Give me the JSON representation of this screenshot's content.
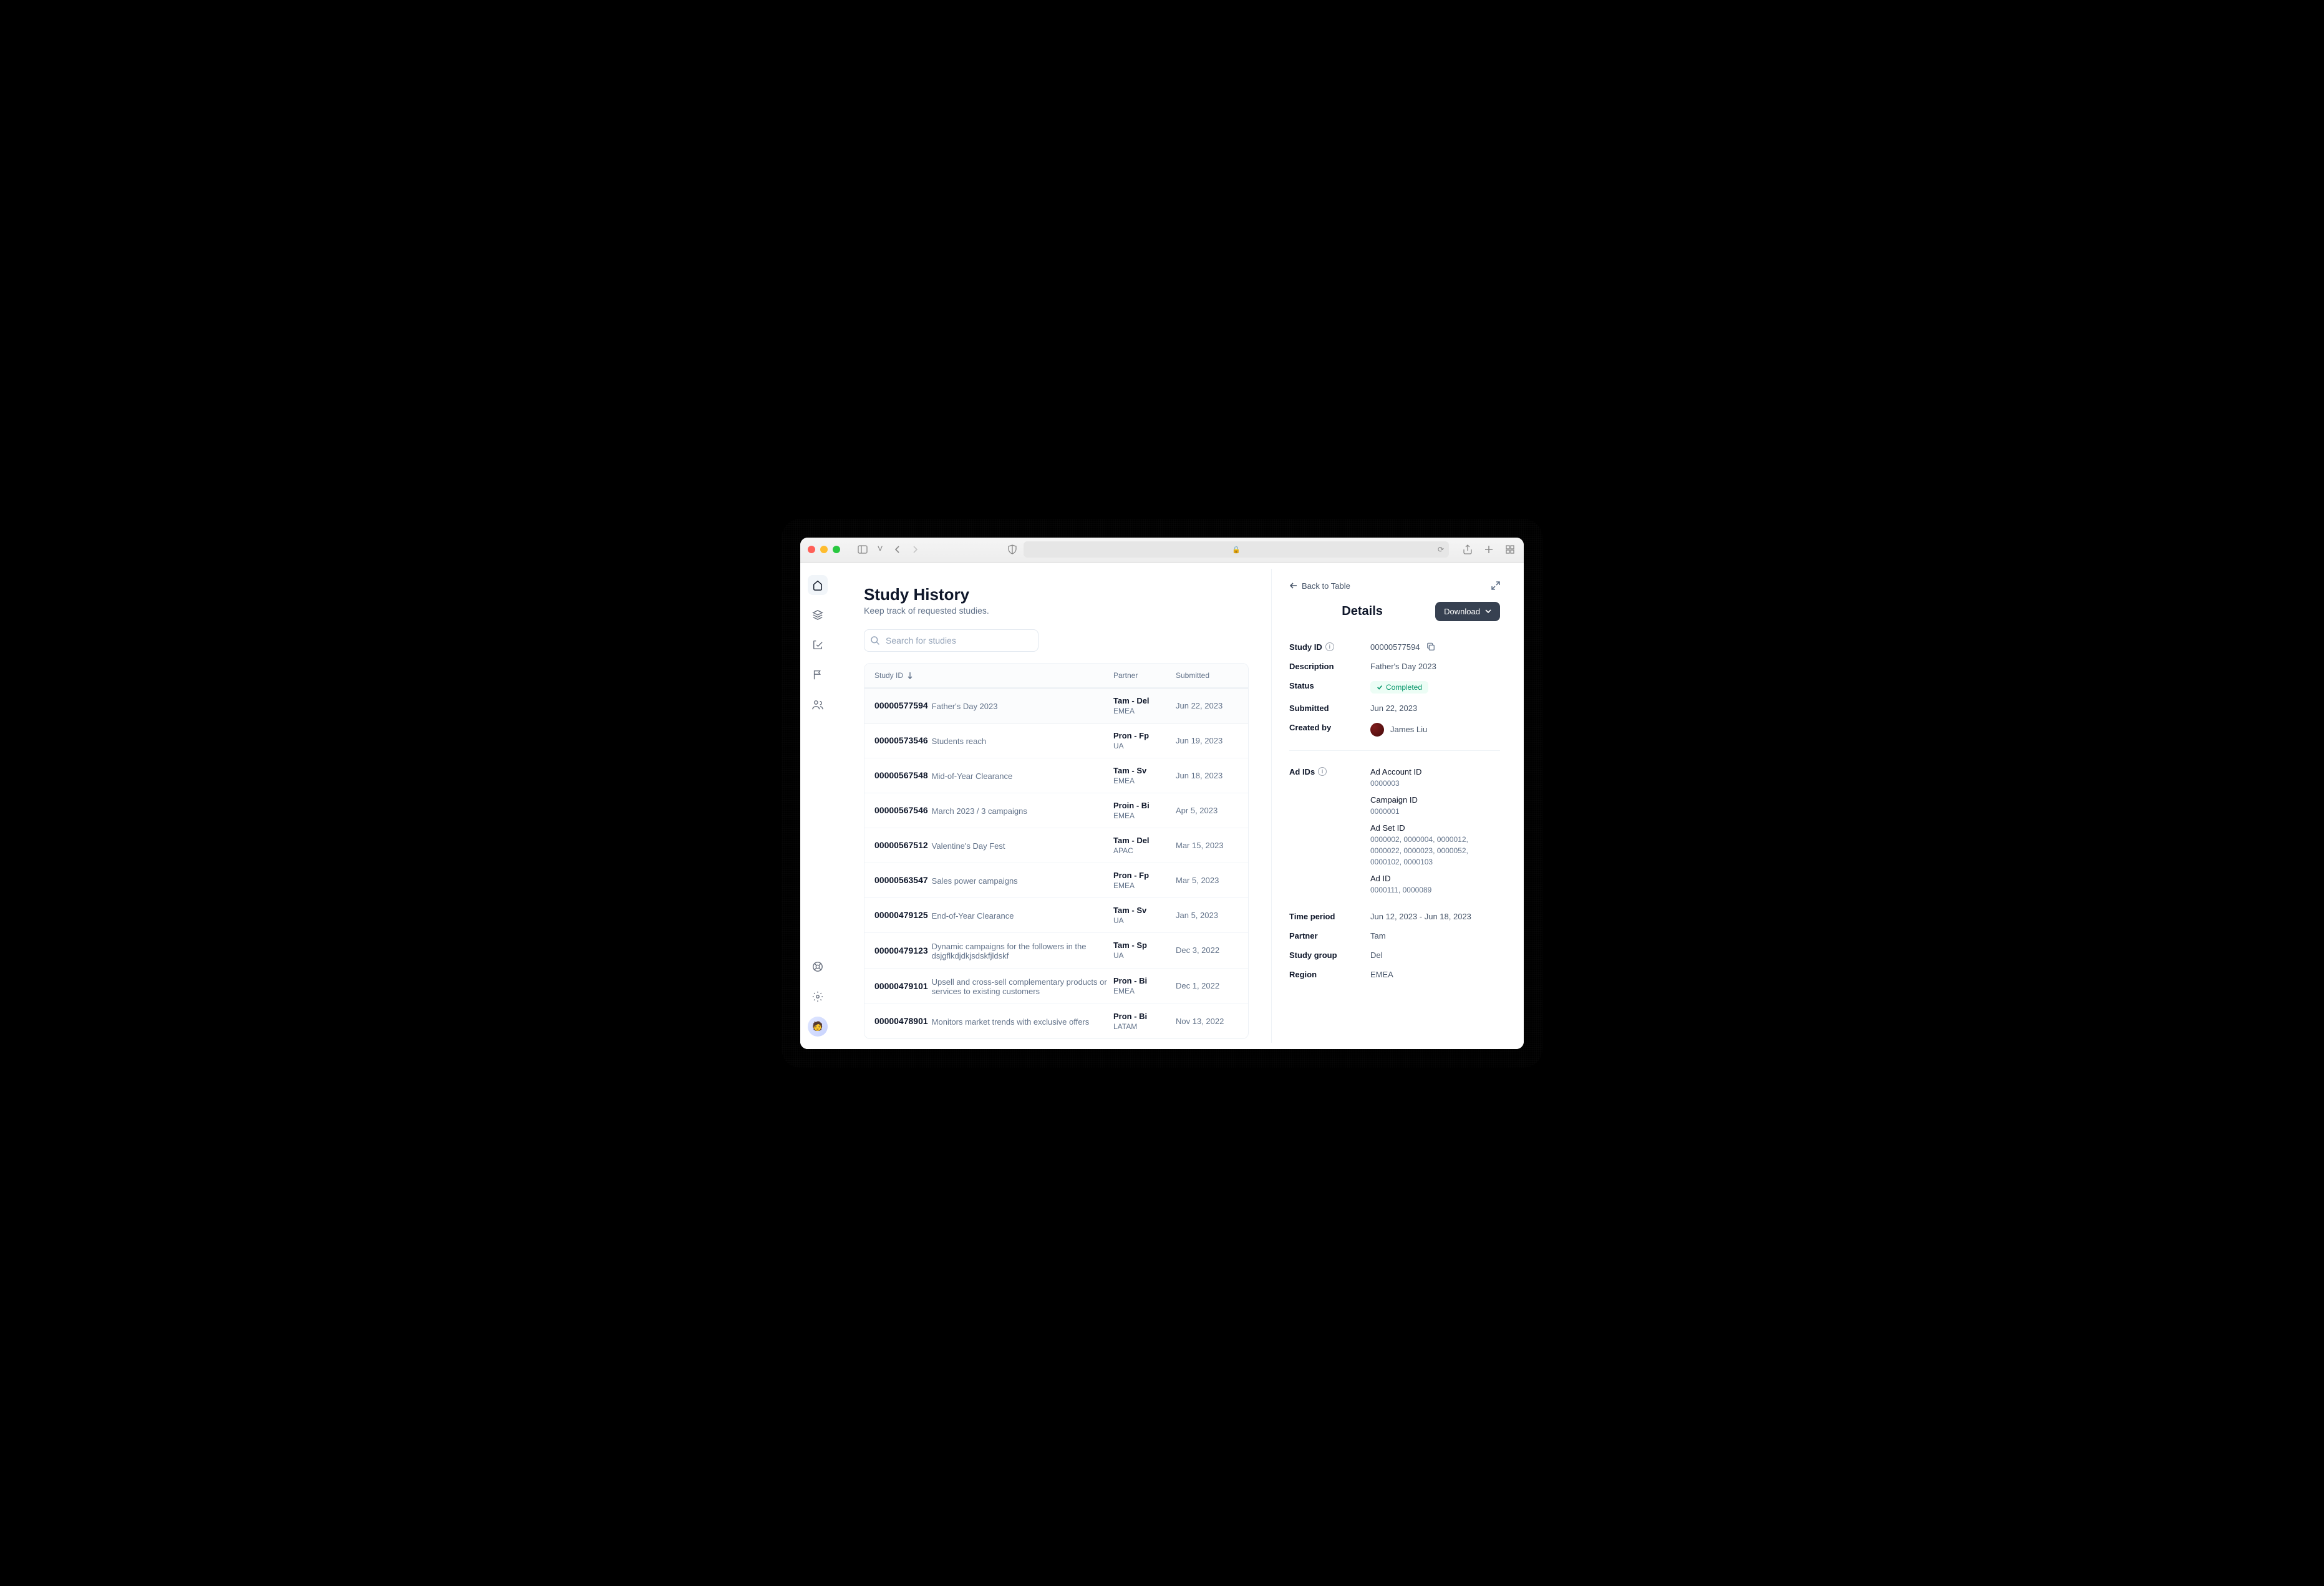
{
  "page": {
    "title": "Study History",
    "subtitle": "Keep track of requested studies."
  },
  "search": {
    "placeholder": "Search for studies"
  },
  "table": {
    "headers": {
      "study_id": "Study ID",
      "partner": "Partner",
      "submitted": "Submitted"
    }
  },
  "studies": [
    {
      "id": "00000577594",
      "desc": "Father's Day 2023",
      "partner": "Tam - Del",
      "region": "EMEA",
      "submitted": "Jun 22, 2023",
      "selected": true
    },
    {
      "id": "00000573546",
      "desc": "Students reach",
      "partner": "Pron - Fp",
      "region": "UA",
      "submitted": "Jun 19, 2023"
    },
    {
      "id": "00000567548",
      "desc": "Mid-of-Year Clearance",
      "partner": "Tam - Sv",
      "region": "EMEA",
      "submitted": "Jun 18, 2023"
    },
    {
      "id": "00000567546",
      "desc": "March 2023 / 3 campaigns",
      "partner": "Proin - Bi",
      "region": "EMEA",
      "submitted": "Apr 5, 2023"
    },
    {
      "id": "00000567512",
      "desc": "Valentine's Day Fest",
      "partner": "Tam - Del",
      "region": "APAC",
      "submitted": "Mar 15, 2023"
    },
    {
      "id": "00000563547",
      "desc": "Sales power campaigns",
      "partner": "Pron - Fp",
      "region": "EMEA",
      "submitted": "Mar 5, 2023"
    },
    {
      "id": "00000479125",
      "desc": "End-of-Year Clearance",
      "partner": "Tam - Sv",
      "region": "UA",
      "submitted": "Jan 5, 2023"
    },
    {
      "id": "00000479123",
      "desc": "Dynamic campaigns for the followers in the dsjgflkdjdkjsdskfjldskf",
      "partner": "Tam - Sp",
      "region": "UA",
      "submitted": "Dec 3, 2022"
    },
    {
      "id": "00000479101",
      "desc": "Upsell and cross-sell complementary products or services to existing customers",
      "partner": "Pron - Bi",
      "region": "EMEA",
      "submitted": "Dec 1, 2022"
    },
    {
      "id": "00000478901",
      "desc": "Monitors market trends with exclusive offers",
      "partner": "Pron - Bi",
      "region": "LATAM",
      "submitted": "Nov 13, 2022"
    }
  ],
  "details": {
    "back_label": "Back to Table",
    "title": "Details",
    "download_label": "Download",
    "labels": {
      "study_id": "Study ID",
      "description": "Description",
      "status": "Status",
      "submitted": "Submitted",
      "created_by": "Created by",
      "ad_ids": "Ad IDs",
      "time_period": "Time period",
      "partner": "Partner",
      "study_group": "Study group",
      "region": "Region"
    },
    "values": {
      "study_id": "00000577594",
      "description": "Father's Day 2023",
      "status": "Completed",
      "submitted": "Jun 22, 2023",
      "created_by": "James Liu",
      "time_period": "Jun 12, 2023 - Jun 18, 2023",
      "partner": "Tam",
      "study_group": "Del",
      "region": "EMEA"
    },
    "ad_ids": [
      {
        "label": "Ad Account ID",
        "value": "0000003"
      },
      {
        "label": "Campaign ID",
        "value": "0000001"
      },
      {
        "label": "Ad Set ID",
        "value": "0000002, 0000004, 0000012, 0000022, 0000023, 0000052, 0000102, 0000103"
      },
      {
        "label": "Ad ID",
        "value": "0000111, 0000089"
      }
    ]
  }
}
